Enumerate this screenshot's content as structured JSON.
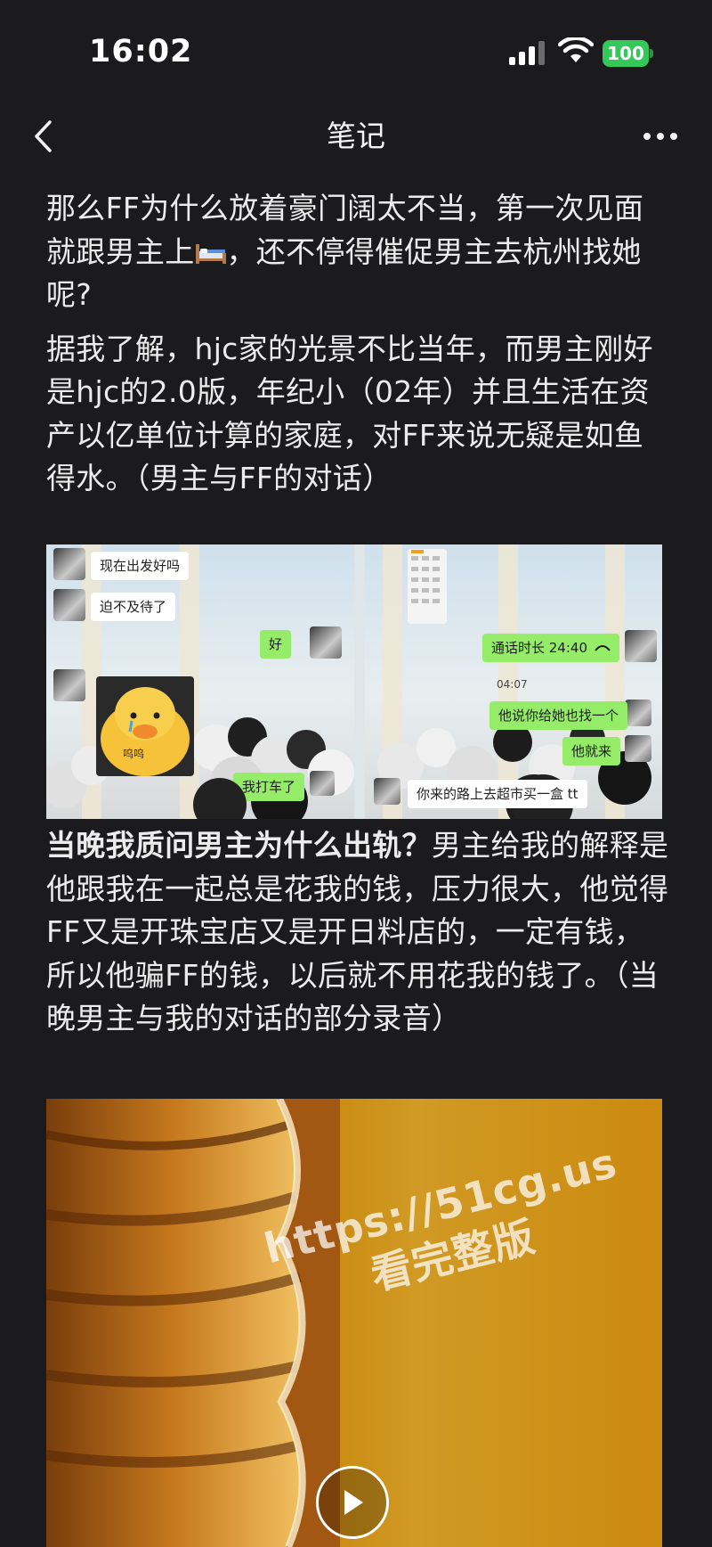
{
  "status_bar": {
    "time": "16:02",
    "battery": "100",
    "icons": [
      "signal-icon",
      "wifi-icon",
      "battery-icon"
    ],
    "battery_color": "#34c759"
  },
  "nav": {
    "title": "笔记",
    "back_icon": "chevron-left-icon",
    "more_icon": "more-icon"
  },
  "article": {
    "para1_a": "那么FF为什么放着豪门阔太不当，第一次见面就跟男主上",
    "para1_emoji": "bed-emoji",
    "para1_b": "，还不停得催促男主去杭州找她呢?",
    "para2": "据我了解，hjc家的光景不比当年，而男主刚好是hjc的2.0版，年纪小（02年）并且生活在资产以亿单位计算的家庭，对FF来说无疑是如鱼得水。（男主与FF的对话）",
    "para3_bold": "当晚我质问男主为什么出轨？",
    "para3_rest": "男主给我的解释是他跟我在一起总是花我的钱，压力很大，他觉得FF又是开珠宝店又是开日料店的，一定有钱，所以他骗FF的钱，以后就不用花我的钱了。（当晚男主与我的对话的部分录音）"
  },
  "chat_screenshot": {
    "left": {
      "msg1": "现在出发好吗",
      "msg2": "迫不及待了",
      "msg3": "好",
      "sticker_text": "呜呜",
      "msg4": "我打车了"
    },
    "right": {
      "call": "通话时长 24:40",
      "time": "04:07",
      "msg1": "他说你给她也找一个",
      "msg2": "他就来",
      "msg3": "你来的路上去超市买一盒 tt"
    }
  },
  "video": {
    "watermark_line1": "https://51cg.us",
    "watermark_line2": "看完整版",
    "play_icon": "play-icon"
  }
}
